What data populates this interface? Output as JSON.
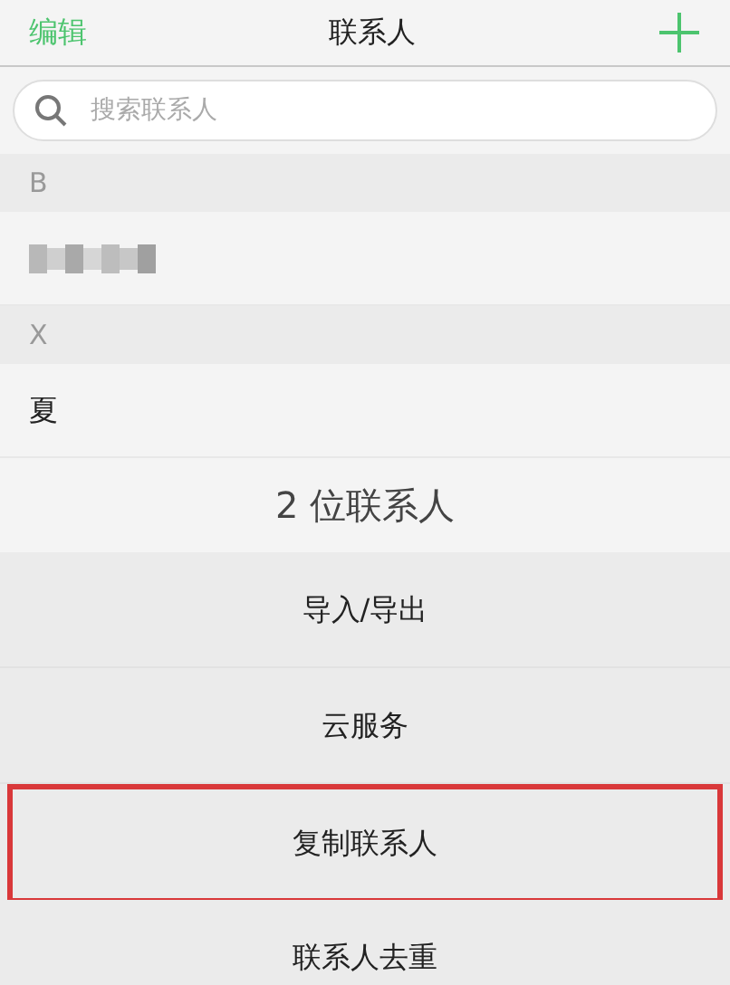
{
  "nav_bar": {
    "left_button": "编辑",
    "title": "联系人"
  },
  "search": {
    "placeholder": "搜索联系人"
  },
  "sections": [
    {
      "letter": "B",
      "contacts": [
        {
          "kind": "redacted"
        }
      ]
    },
    {
      "letter": "X",
      "contacts": [
        {
          "kind": "name",
          "name": "夏"
        }
      ]
    }
  ],
  "contact_count": "2 位联系人",
  "actions": [
    {
      "label": "导入/导出",
      "highlighted": false
    },
    {
      "label": "云服务",
      "highlighted": false
    },
    {
      "label": "复制联系人",
      "highlighted": true
    },
    {
      "label": "联系人去重",
      "highlighted": false
    }
  ]
}
